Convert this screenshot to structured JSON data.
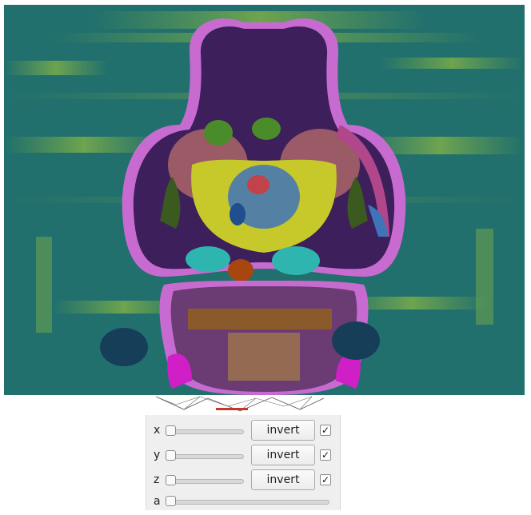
{
  "viewer": {
    "background_color": "#22706e",
    "region_colors": {
      "cortex": "#3d1f5c",
      "cortex_outline": "#c86bd1",
      "striatum": "#9a5a66",
      "thalamus": "#c7c92a",
      "hypothalamus": "#3f74b9",
      "cerebellum": "#6b3b73",
      "midbrain": "#8b5a2b",
      "hippocampus": "#2fb5b0",
      "accent_magenta": "#d11fc8"
    }
  },
  "controls": {
    "rows": [
      {
        "axis": "x",
        "button": "invert",
        "checked": true,
        "checkmark": "✓"
      },
      {
        "axis": "y",
        "button": "invert",
        "checked": true,
        "checkmark": "✓"
      },
      {
        "axis": "z",
        "button": "invert",
        "checked": true,
        "checkmark": "✓"
      }
    ],
    "alpha": {
      "axis": "a"
    }
  }
}
